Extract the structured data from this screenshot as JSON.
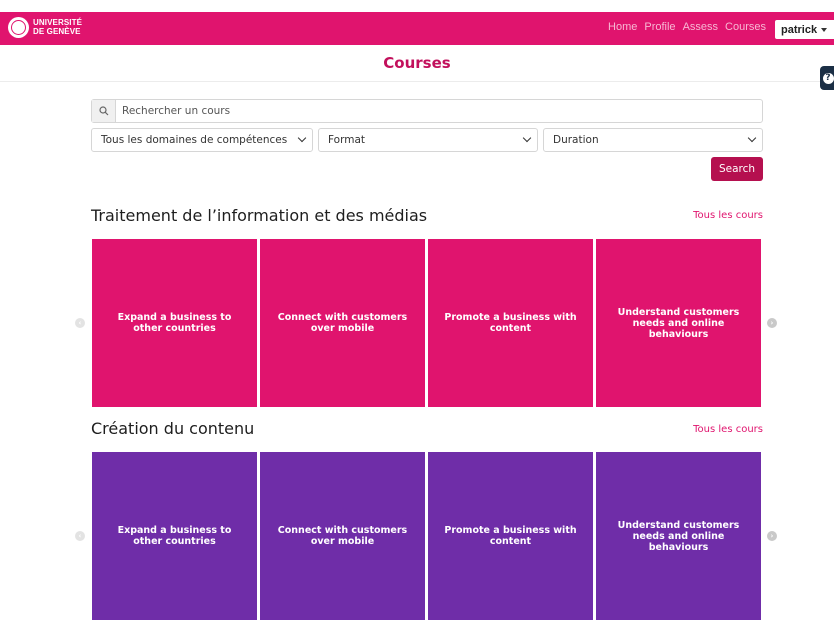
{
  "header": {
    "logo_text": "UNIVERSITÉ DE GENÈVE",
    "logo_line1": "UNIVERSITÉ",
    "logo_line2": "DE GENÈVE",
    "nav": [
      "Home",
      "Profile",
      "Assess",
      "Courses"
    ],
    "user": "patrick"
  },
  "page": {
    "title": "Courses"
  },
  "filters": {
    "search_placeholder": "Rechercher un cours",
    "domain": "Tous les domaines de compétences",
    "format": "Format",
    "duration": "Duration",
    "search_button": "Search"
  },
  "sections": [
    {
      "title": "Traitement de l’information et des médias",
      "link": "Tous les cours",
      "cards": [
        "Expand a business to other countries",
        "Connect with customers over mobile",
        "Promote a business with content",
        "Understand customers needs and online behaviours"
      ]
    },
    {
      "title": "Création du contenu",
      "link": "Tous les cours",
      "cards": [
        "Expand a business to other countries",
        "Connect with customers over mobile",
        "Promote a business with content",
        "Understand customers needs and online behaviours"
      ]
    }
  ],
  "colors": {
    "brand_pink": "#e0146e",
    "brand_purple": "#6f2da8",
    "button": "#b5104f",
    "help": "#1b2f45"
  },
  "icons": {
    "search": "search-icon",
    "help": "help-icon",
    "prev": "chevron-left-icon",
    "next": "chevron-right-icon",
    "dropdown": "chevron-down-icon"
  }
}
